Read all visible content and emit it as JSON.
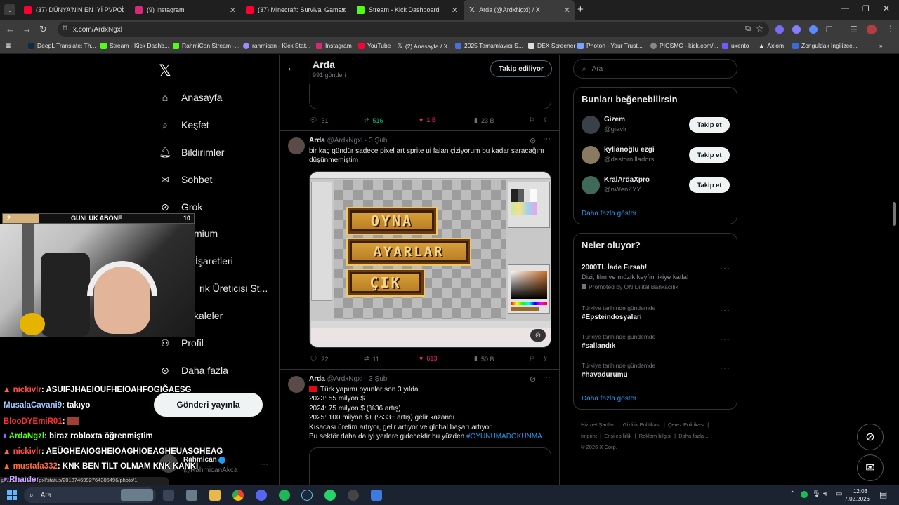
{
  "browser": {
    "tabs": [
      {
        "label": "(37) DÜNYA'NIN EN İYİ PVPCİSİ",
        "color": "#ff0033"
      },
      {
        "label": "(9) Instagram",
        "color": "#d62976"
      },
      {
        "label": "(37) Minecraft: Survival Games",
        "color": "#ff0033"
      },
      {
        "label": "Stream - Kick Dashboard",
        "color": "#53fc18"
      },
      {
        "label": "Arda (@ArdxNgxl) / X",
        "color": "#ffffff"
      }
    ],
    "new_tab": "+",
    "url": "x.com/ArdxNgxl",
    "bookmarks": [
      "DeepL Translate: Th...",
      "Stream - Kick Dashb...",
      "RahmiCan Stream -...",
      "rahmican - Kick Stat...",
      "Instagram",
      "YouTube",
      "(2) Anasayfa / X",
      "2025 Tamamlayıcı S...",
      "DEX Screener",
      "Photon - Your Trust...",
      "PIGSMC - kick.com/...",
      "uxento",
      "Axiom",
      "Zonguldak İngilizce..."
    ]
  },
  "nav": {
    "items": [
      "Anasayfa",
      "Keşfet",
      "Bildirimler",
      "Sohbet",
      "Grok",
      "mium",
      "İşaretleri",
      "rik Üreticisi St...",
      "kaleler",
      "Profil",
      "Daha fazla"
    ],
    "post_button": "Gönderi yayınla",
    "account_name": "Rahmican",
    "account_handle": "@RahmicanAkca"
  },
  "header": {
    "name": "Arda",
    "posts_count": "991 gönderi",
    "follow_state": "Takip ediliyor"
  },
  "prev_stats": {
    "replies": "31",
    "reposts": "516",
    "likes": "1 B",
    "views": "23 B"
  },
  "tweet1": {
    "name": "Arda",
    "handle": "@ArdxNgxl",
    "date": "· 3 Şub",
    "text": "bir kaç gündür sadece pixel art sprite ui falan çiziyorum bu kadar saracağını düşünmemiştim",
    "image_buttons": [
      "OYNA",
      "AYARLAR",
      "ÇIK"
    ],
    "stats": {
      "replies": "22",
      "reposts": "11",
      "likes": "613",
      "views": "50 B"
    }
  },
  "tweet2": {
    "name": "Arda",
    "handle": "@ArdxNgxl",
    "date": "· 3 Şub",
    "lines": [
      "Türk yapımı oyunlar son 3 yılda",
      "2023: 55 milyon $",
      "2024: 75 milyon $ (%36 artış)",
      "2025: 100 milyon $+ (%33+ artış) gelir kazandı.",
      "Kısacası üretim artıyor, gelir artıyor ve global başarı artıyor.",
      "Bu sektör daha da iyi yerlere gidecektir bu yüzden"
    ],
    "hashtag": "#OYUNUMADOKUNMA"
  },
  "search": {
    "placeholder": "Ara"
  },
  "who_to_follow": {
    "title": "Bunları beğenebilirsin",
    "users": [
      {
        "name": "Gizem",
        "handle": "@giavlr",
        "button": "Takip et"
      },
      {
        "name": "kylianoğlu ezgi",
        "handle": "@destornilladors",
        "button": "Takip et"
      },
      {
        "name": "KralArdaXpro",
        "handle": "@nWenZYY",
        "button": "Takip et"
      }
    ],
    "more": "Daha fazla göster"
  },
  "trends": {
    "title": "Neler oluyor?",
    "promo": {
      "title": "2000TL İade Fırsatı!",
      "desc": "Dizi, film ve müzik keyfini ikiye katla!",
      "promoted": "Promoted by ON Dijital Bankacılık"
    },
    "items": [
      {
        "context": "Türkiye tarihinde gündemde",
        "tag": "#Epsteindosyalari"
      },
      {
        "context": "Türkiye tarihinde gündemde",
        "tag": "#sallandık"
      },
      {
        "context": "Türkiye tarihinde gündemde",
        "tag": "#havadurumu"
      }
    ],
    "more": "Daha fazla göster"
  },
  "footer": {
    "links": [
      "Hizmet Şartları",
      "Gizlilik Politikası",
      "Çerez Politikası",
      "Imprint",
      "Erişilebilirlik",
      "Reklam bilgisi",
      "Daha fazla ..."
    ],
    "copyright": "© 2026 X Corp."
  },
  "overlay": {
    "sub_goal_current": "2",
    "sub_goal_label": "GUNLUK ABONE",
    "sub_goal_target": "10",
    "chat": [
      {
        "user": "nickivlr",
        "msg": ": ASUIFJHAEIOUFHEIOAHFOGIĞAESG",
        "color": "#ff4d4d"
      },
      {
        "user": "MusalaCavani9",
        "msg": ": takıyo",
        "color": "#9ecbff"
      },
      {
        "user": "BlooDYEmiR01",
        "msg": ":",
        "color": "#ff3030"
      },
      {
        "user": "ArdaNgzl",
        "msg": ": biraz robloxta öğrenmiştim",
        "color": "#53fc18"
      },
      {
        "user": "nickivlr",
        "msg": ": AEÜGHEAIOGHEIOAGHIOEAGHEUASGHEAG",
        "color": "#ff4d4d"
      },
      {
        "user": "mustafa332",
        "msg": ": KNK BEN TİLT OLMAM KNK KANKİ",
        "color": "#ff6a3d"
      },
      {
        "user": "Rhaider",
        "msg": "",
        "color": "#c9a3ff"
      }
    ],
    "status_url": "p://x.com/ArdxNgxl/status/2018746992764305496/photo/1"
  },
  "taskbar": {
    "search": "Ara",
    "time": "12:03",
    "date": "7.02.2026"
  }
}
